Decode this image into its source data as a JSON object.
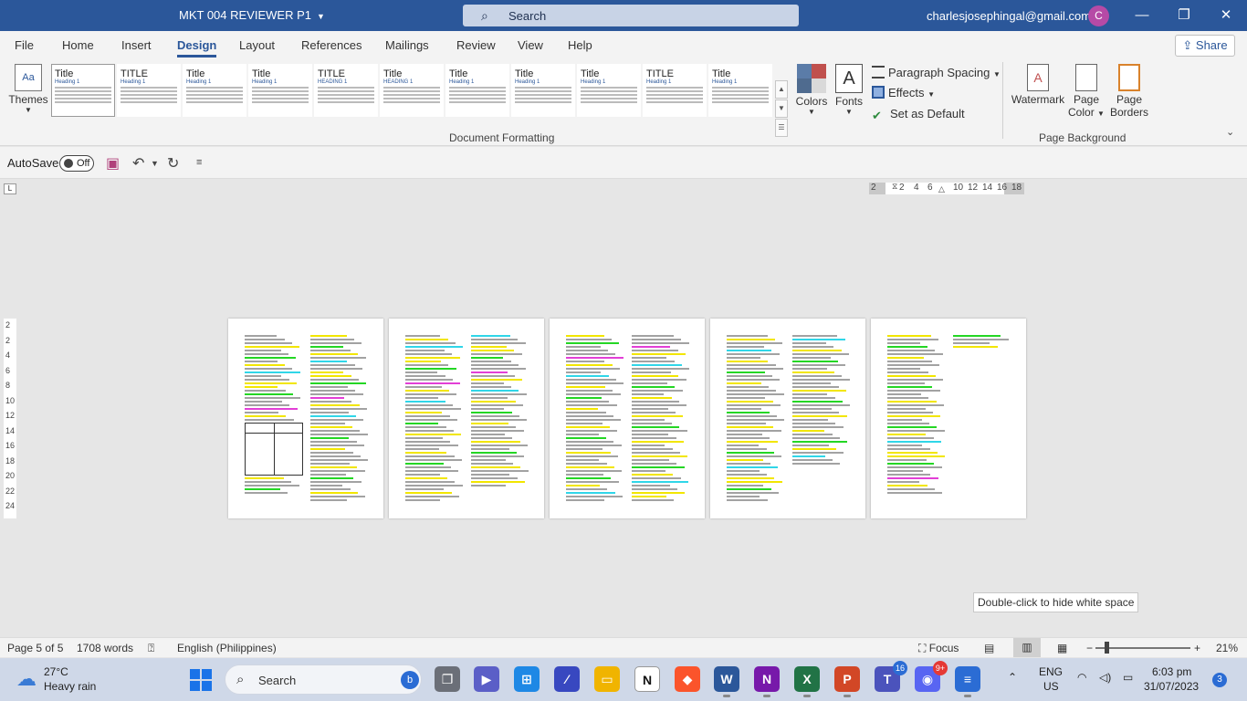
{
  "window": {
    "doc_title": "MKT 004 REVIEWER P1",
    "search_label": "Search",
    "account_email": "charlesjosephingal@gmail.com",
    "avatar_initial": "C"
  },
  "tabs": [
    "File",
    "Home",
    "Insert",
    "Design",
    "Layout",
    "References",
    "Mailings",
    "Review",
    "View",
    "Help"
  ],
  "active_tab": "Design",
  "share_label": "Share",
  "ribbon": {
    "themes_label": "Themes",
    "themes_icon_text": "Aa",
    "style_gallery": [
      {
        "title": "Title",
        "heading": "Heading 1"
      },
      {
        "title": "TITLE",
        "heading": "Heading 1"
      },
      {
        "title": "Title",
        "heading": "Heading 1"
      },
      {
        "title": "Title",
        "heading": "Heading 1"
      },
      {
        "title": "TITLE",
        "heading": "HEADING 1"
      },
      {
        "title": "Title",
        "heading": "HEADING 1"
      },
      {
        "title": "Title",
        "heading": "Heading 1"
      },
      {
        "title": "Title",
        "heading": "Heading 1"
      },
      {
        "title": "Title",
        "heading": "Heading 1"
      },
      {
        "title": "TITLE",
        "heading": "Heading 1"
      },
      {
        "title": "Title",
        "heading": "Heading 1"
      }
    ],
    "colors_label": "Colors",
    "fonts_label": "Fonts",
    "fonts_icon_text": "A",
    "paragraph_spacing_label": "Paragraph Spacing",
    "effects_label": "Effects",
    "set_default_label": "Set as Default",
    "document_formatting_label": "Document Formatting",
    "watermark_label": "Watermark",
    "page_color_label_1": "Page",
    "page_color_label_2": "Color",
    "page_borders_label_1": "Page",
    "page_borders_label_2": "Borders",
    "page_background_label": "Page Background"
  },
  "qat": {
    "autosave_label": "AutoSave",
    "autosave_state": "Off"
  },
  "ruler": {
    "corner_glyph": "L",
    "h_ticks": [
      "2",
      "2",
      "4",
      "6",
      "10",
      "12",
      "14",
      "16",
      "18"
    ],
    "v_ticks": [
      "2",
      "2",
      "4",
      "6",
      "8",
      "10",
      "12",
      "14",
      "16",
      "18",
      "20",
      "22",
      "24"
    ]
  },
  "tooltip": "Double-click to hide white space",
  "status": {
    "page": "Page 5 of 5",
    "words": "1708 words",
    "language": "English (Philippines)",
    "focus_label": "Focus",
    "zoom": "21%"
  },
  "taskbar": {
    "temp": "27°C",
    "condition": "Heavy rain",
    "search_label": "Search",
    "teams_badge": "16",
    "discord_badge": "9+",
    "language_line1": "ENG",
    "language_line2": "US",
    "time": "6:03 pm",
    "date": "31/07/2023",
    "notification_count": "3"
  },
  "colors": {
    "word_blue": "#2b579a",
    "highlight_yellow": "#f2e600",
    "highlight_green": "#24d624",
    "highlight_cyan": "#30d6e8",
    "highlight_magenta": "#e23fd6"
  }
}
